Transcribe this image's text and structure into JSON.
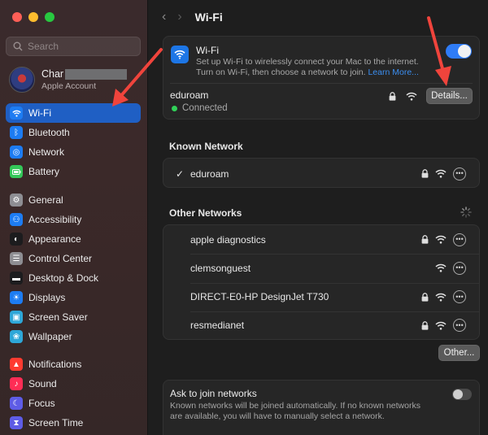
{
  "sidebar": {
    "search_placeholder": "Search",
    "account": {
      "name": "Char",
      "subtitle": "Apple Account"
    },
    "groups": [
      [
        {
          "label": "Wi-Fi",
          "icon": "wifi-icon",
          "color": "#1d7cf2",
          "active": true
        },
        {
          "label": "Bluetooth",
          "icon": "bluetooth-icon",
          "color": "#1d7cf2"
        },
        {
          "label": "Network",
          "icon": "globe-icon",
          "color": "#1d7cf2"
        },
        {
          "label": "Battery",
          "icon": "battery-icon",
          "color": "#34c759"
        }
      ],
      [
        {
          "label": "General",
          "icon": "gear-icon",
          "color": "#8e8e93"
        },
        {
          "label": "Accessibility",
          "icon": "accessibility-icon",
          "color": "#1d7cf2"
        },
        {
          "label": "Appearance",
          "icon": "appearance-icon",
          "color": "#1c1c1e"
        },
        {
          "label": "Control Center",
          "icon": "control-center-icon",
          "color": "#8e8e93"
        },
        {
          "label": "Desktop & Dock",
          "icon": "dock-icon",
          "color": "#1c1c1e"
        },
        {
          "label": "Displays",
          "icon": "display-icon",
          "color": "#1d7cf2"
        },
        {
          "label": "Screen Saver",
          "icon": "screen-saver-icon",
          "color": "#2ea7d8"
        },
        {
          "label": "Wallpaper",
          "icon": "wallpaper-icon",
          "color": "#2ea7d8"
        }
      ],
      [
        {
          "label": "Notifications",
          "icon": "bell-icon",
          "color": "#ff3b30"
        },
        {
          "label": "Sound",
          "icon": "speaker-icon",
          "color": "#ff2d55"
        },
        {
          "label": "Focus",
          "icon": "moon-icon",
          "color": "#5e5ce6"
        },
        {
          "label": "Screen Time",
          "icon": "hourglass-icon",
          "color": "#5e5ce6"
        }
      ]
    ]
  },
  "header": {
    "title": "Wi-Fi"
  },
  "wifi": {
    "title": "Wi-Fi",
    "description": "Set up Wi-Fi to wirelessly connect your Mac to the internet. Turn on Wi-Fi, then choose a network to join.",
    "learn_more": "Learn More...",
    "enabled": true,
    "current_network": "eduroam",
    "status": "Connected",
    "details_label": "Details..."
  },
  "known": {
    "heading": "Known Network",
    "networks": [
      {
        "name": "eduroam",
        "checked": true,
        "locked": true
      }
    ]
  },
  "other": {
    "heading": "Other Networks",
    "networks": [
      {
        "name": "apple diagnostics",
        "locked": true
      },
      {
        "name": "clemsonguest",
        "locked": false
      },
      {
        "name": "DIRECT-E0-HP DesignJet T730",
        "locked": true
      },
      {
        "name": "resmedianet",
        "locked": true
      }
    ],
    "other_button": "Other..."
  },
  "ask": {
    "title": "Ask to join networks",
    "description": "Known networks will be joined automatically. If no known networks are available, you will have to manually select a network.",
    "enabled": false
  },
  "colors": {
    "accent": "#1f5fc4",
    "annotation_arrow": "#f0443c"
  }
}
